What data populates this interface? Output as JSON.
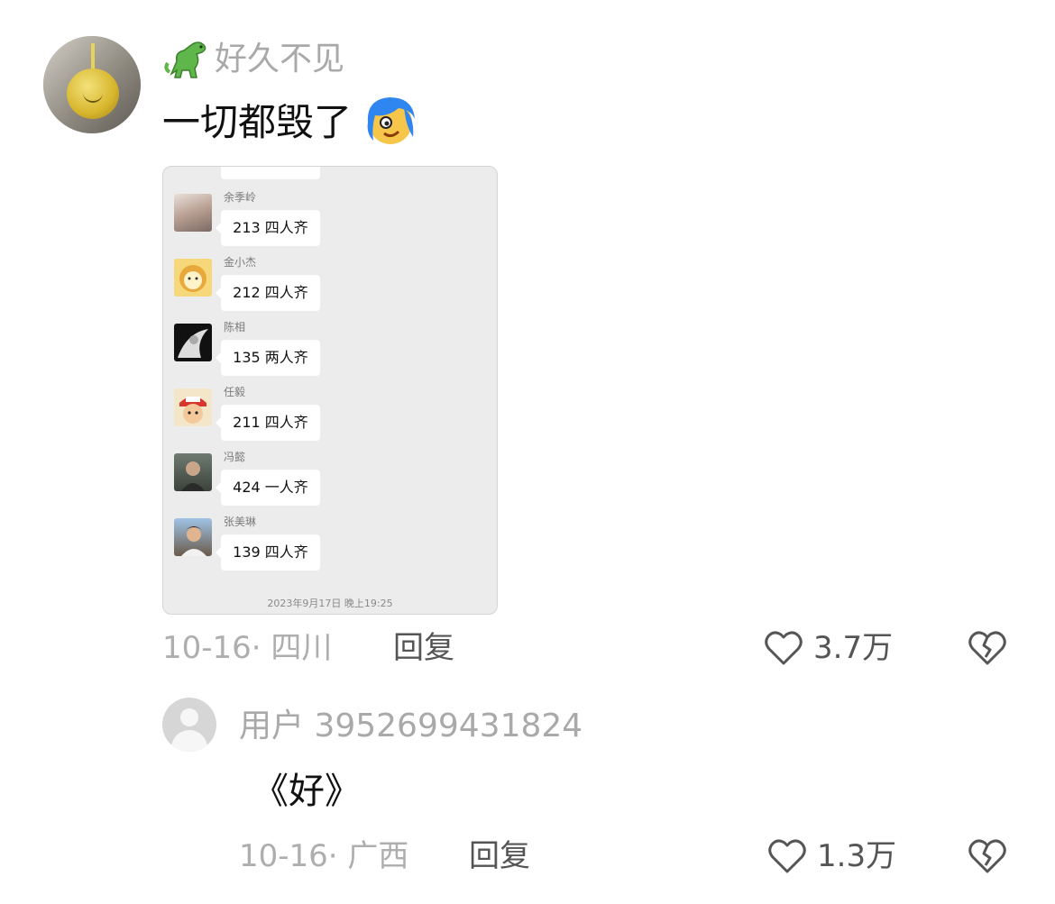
{
  "main_comment": {
    "username": "好久不见",
    "text": "一切都毁了",
    "date": "10-16",
    "location": "四川",
    "reply_label": "回复",
    "like_count": "3.7万",
    "attached_image": {
      "messages": [
        {
          "name": "余季岭",
          "text": "213 四人齐"
        },
        {
          "name": "金小杰",
          "text": "212 四人齐"
        },
        {
          "name": "陈相",
          "text": "135 两人齐"
        },
        {
          "name": "任毅",
          "text": "211 四人齐"
        },
        {
          "name": "冯懿",
          "text": "424 一人齐"
        },
        {
          "name": "张美琳",
          "text": "139 四人齐"
        }
      ],
      "timestamp": "2023年9月17日 晚上19:25"
    }
  },
  "reply_comment": {
    "username": "用户 3952699431824",
    "text": "《好》",
    "date": "10-16",
    "location": "广西",
    "reply_label": "回复",
    "like_count": "1.3万"
  },
  "colors": {
    "meta_gray": "#aeaeae",
    "bubble_bg": "#ffffff",
    "chat_bg": "#ececec"
  },
  "icons": {
    "dino": "dinosaur-icon",
    "emoji": "blue-hair-emoji-icon",
    "like": "heart-outline-icon",
    "dislike": "broken-heart-icon"
  }
}
